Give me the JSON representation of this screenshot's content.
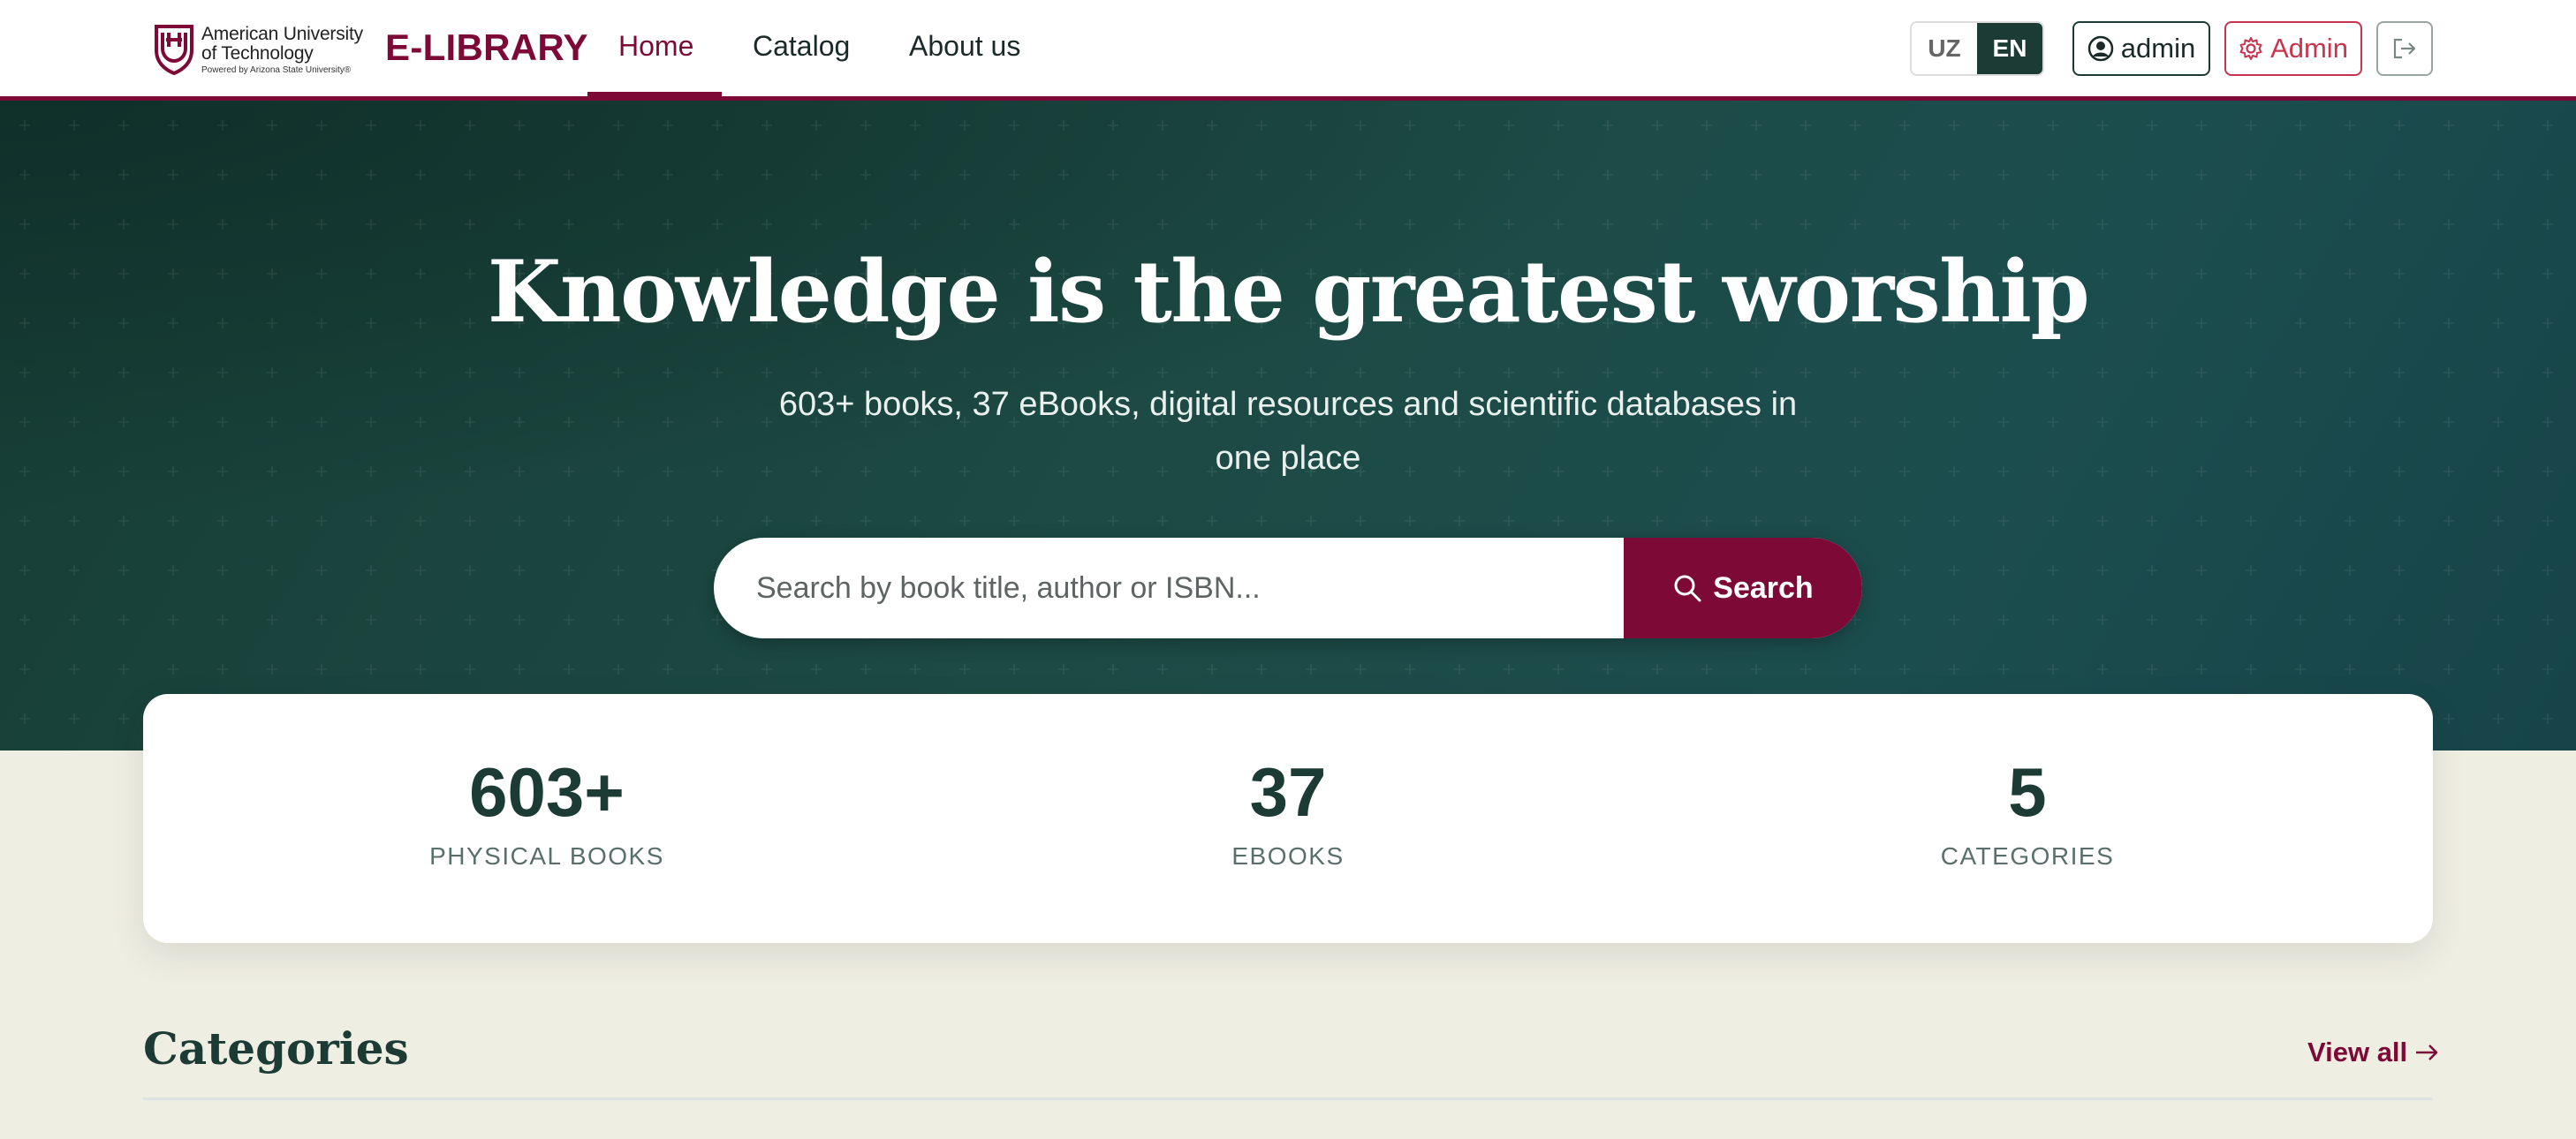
{
  "header": {
    "logo": {
      "line1": "American University",
      "line2": "of Technology",
      "line3": "Powered by Arizona State University®"
    },
    "brand": "E-LIBRARY",
    "nav": [
      {
        "label": "Home",
        "active": true
      },
      {
        "label": "Catalog",
        "active": false
      },
      {
        "label": "About us",
        "active": false
      }
    ],
    "languages": [
      {
        "label": "UZ",
        "active": false
      },
      {
        "label": "EN",
        "active": true
      }
    ],
    "user_label": "admin",
    "admin_label": "Admin",
    "colors": {
      "brand": "#7d0a36",
      "dark_green": "#1c3b35",
      "admin_red": "#c8344d"
    }
  },
  "hero": {
    "title": "Knowledge is the greatest worship",
    "subtitle": "603+ books, 37 eBooks, digital resources and scientific databases in one place",
    "search": {
      "placeholder": "Search by book title, author or ISBN...",
      "button_label": "Search"
    }
  },
  "stats": [
    {
      "value": "603+",
      "label": "PHYSICAL BOOKS"
    },
    {
      "value": "37",
      "label": "EBOOKS"
    },
    {
      "value": "5",
      "label": "CATEGORIES"
    }
  ],
  "categories": {
    "title": "Categories",
    "view_all": "View all"
  },
  "icons": [
    "university-logo-icon",
    "user-circle-icon",
    "gear-icon",
    "logout-icon",
    "search-icon",
    "arrow-right-icon"
  ]
}
